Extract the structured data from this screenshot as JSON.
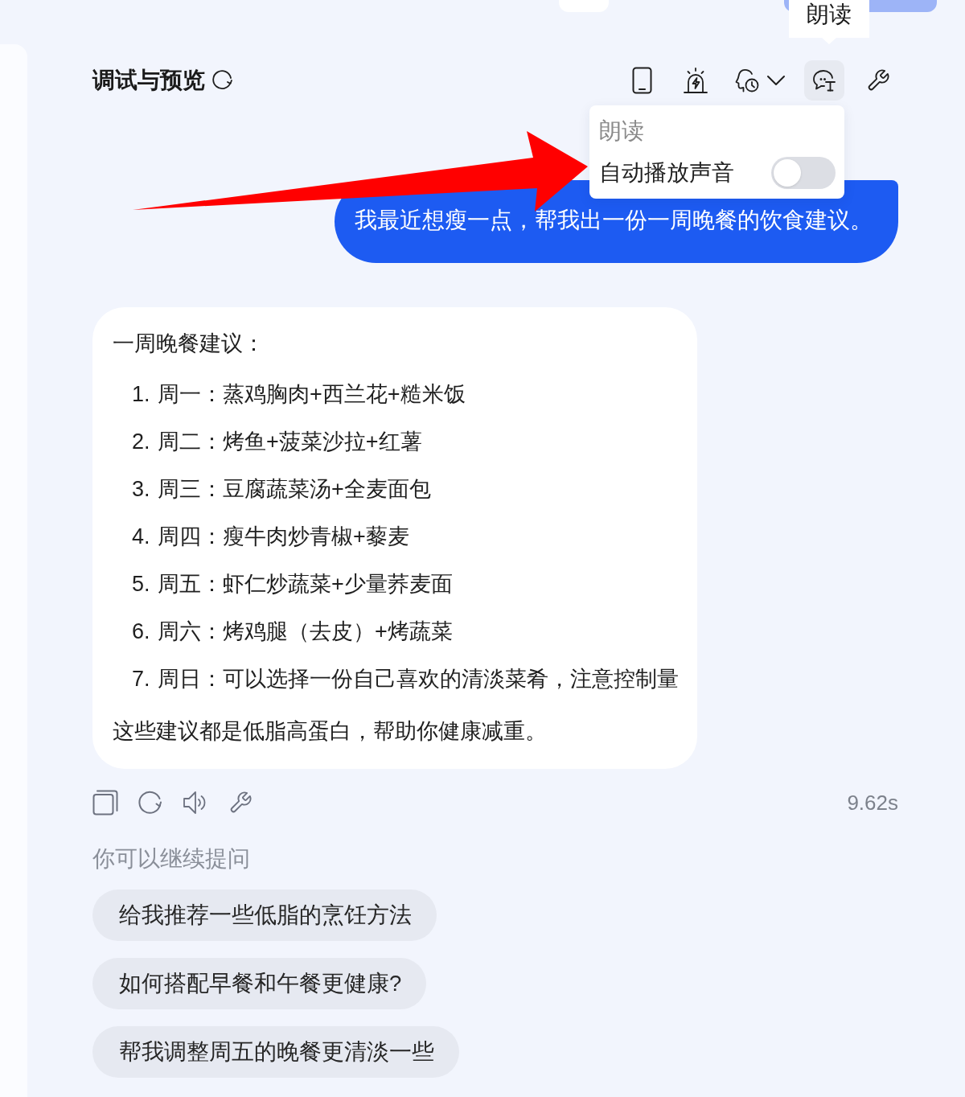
{
  "header": {
    "title": "调试与预览"
  },
  "toolbar": {
    "buttons": [
      {
        "kind": "phone",
        "selected": false
      },
      {
        "kind": "alarm",
        "selected": false
      },
      {
        "kind": "voice",
        "selected": false
      },
      {
        "kind": "read-aloud",
        "selected": true
      },
      {
        "kind": "wrench",
        "selected": false
      }
    ],
    "tooltip": "朗读",
    "popover": {
      "title": "朗读",
      "items": [
        {
          "label": "自动播放声音",
          "on": false
        }
      ]
    }
  },
  "messages": [
    {
      "kind": "user",
      "text": "我最近想瘦一点，帮我出一份一周晚餐的饮食建议。"
    },
    {
      "kind": "answer",
      "heading": "一周晚餐建议：",
      "items": [
        {
          "number": "1.",
          "text": "周一：蒸鸡胸肉+西兰花+糙米饭"
        },
        {
          "number": "2.",
          "text": "周二：烤鱼+菠菜沙拉+红薯"
        },
        {
          "number": "3.",
          "text": "周三：豆腐蔬菜汤+全麦面包"
        },
        {
          "number": "4.",
          "text": "周四：瘦牛肉炒青椒+藜麦"
        },
        {
          "number": "5.",
          "text": "周五：虾仁炒蔬菜+少量荞麦面"
        },
        {
          "number": "6.",
          "text": "周六：烤鸡腿（去皮）+烤蔬菜"
        },
        {
          "number": "7.",
          "text": "周日：可以选择一份自己喜欢的清淡菜肴，注意控制量"
        }
      ],
      "closing": "这些建议都是低脂高蛋白，帮助你健康减重。"
    }
  ],
  "actions": {
    "buttons": [
      {
        "kind": "copy"
      },
      {
        "kind": "regenerate"
      },
      {
        "kind": "speaker"
      },
      {
        "kind": "wrench"
      }
    ],
    "duration": "9.62s"
  },
  "suggestions": {
    "label": "你可以继续提问",
    "items": [
      "给我推荐一些低脂的烹饪方法",
      "如何搭配早餐和午餐更健康?",
      "帮我调整周五的晚餐更清淡一些"
    ]
  }
}
